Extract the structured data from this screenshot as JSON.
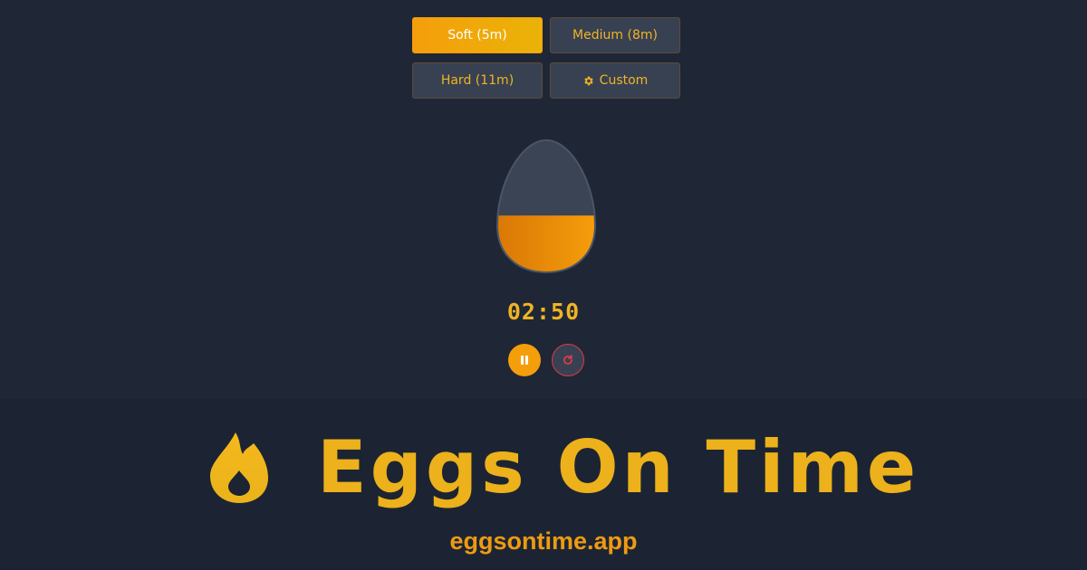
{
  "presets": [
    {
      "label": "Soft (5m)",
      "active": true
    },
    {
      "label": "Medium (8m)",
      "active": false
    },
    {
      "label": "Hard (11m)",
      "active": false
    },
    {
      "label": "Custom",
      "active": false,
      "icon": "gear-icon"
    }
  ],
  "timer": {
    "display": "02:50",
    "progress_fraction": 0.43
  },
  "controls": {
    "pause_icon": "pause-icon",
    "reset_icon": "reset-icon"
  },
  "branding": {
    "name": "Eggs On Time",
    "domain": "eggsontime.app",
    "logo_icon": "flame-icon"
  },
  "colors": {
    "background": "#1f2736",
    "accent": "#f59e0b",
    "text_accent": "#f0b423",
    "button_bg": "#384152",
    "reset_border": "#dc3a4a"
  }
}
